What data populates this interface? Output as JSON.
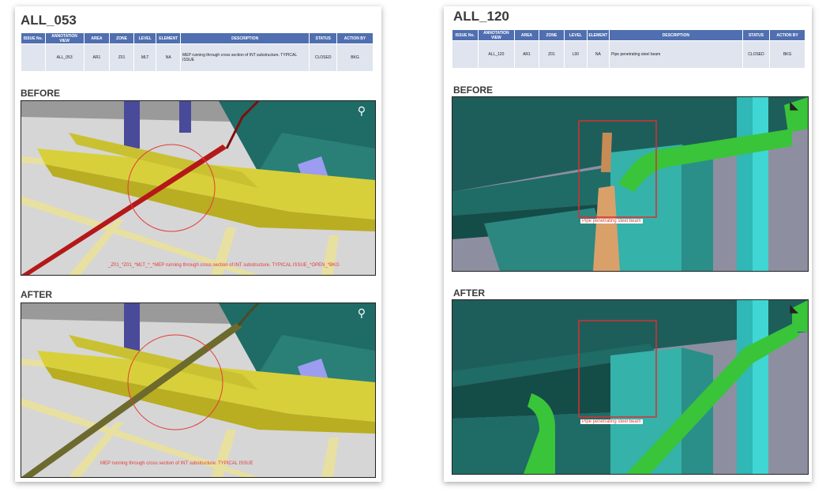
{
  "issues": [
    {
      "title": "ALL_053",
      "headers": [
        "ISSUE No.",
        "ANNOTATION VIEW",
        "AREA",
        "ZONE",
        "LEVEL",
        "ELEMENT",
        "DESCRIPTION",
        "STATUS",
        "ACTION BY"
      ],
      "row": {
        "issue_no": "",
        "annotation_view": "ALL_053",
        "area": "AR1",
        "zone": "Z01",
        "level": "MLT",
        "element": "NA",
        "description": "MEP running through cross section of INT substructure. TYPICAL ISSUE",
        "status": "CLOSED",
        "action_by": "BKG"
      },
      "before_label": "BEFORE",
      "after_label": "AFTER",
      "before_caption": "_Z01_*Z01_*MLT_*_*MEP running through cross section of INT substructure. TYPICAL ISSUE_*OPEN_*BKG",
      "after_caption": "MEP running through cross section of INT substructure. TYPICAL ISSUE"
    },
    {
      "title": "ALL_120",
      "headers": [
        "ISSUE No.",
        "ANNOTATION VIEW",
        "AREA",
        "ZONE",
        "LEVEL",
        "ELEMENT",
        "DESCRIPTION",
        "STATUS",
        "ACTION BY"
      ],
      "row": {
        "issue_no": "",
        "annotation_view": "ALL_120",
        "area": "AR1",
        "zone": "Z01",
        "level": "L00",
        "element": "NA",
        "description": "Pipe penetrating steel beam",
        "status": "CLOSED",
        "action_by": "BKG"
      },
      "before_label": "BEFORE",
      "after_label": "AFTER",
      "before_caption": "Pipe penetrating steel beam",
      "after_caption": "Pipe penetrating steel beam"
    }
  ],
  "colors": {
    "table_header": "#4f6fb0",
    "table_row": "#dfe4ee",
    "annotation_red": "#e23b3b",
    "beam_yellow": "#d8d03a",
    "structure_teal": "#1f6b66",
    "pipe_green": "#39c43a",
    "steel_cyan": "#3fd6d3"
  }
}
